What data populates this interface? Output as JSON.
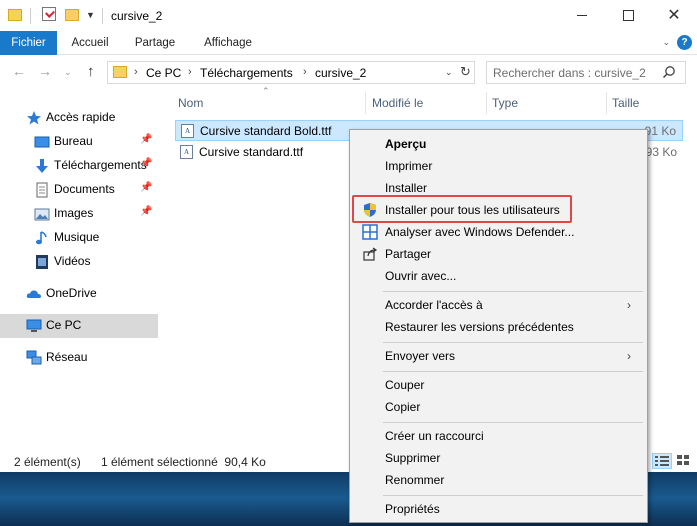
{
  "window": {
    "title": "cursive_2"
  },
  "ribbon": {
    "tabs": [
      {
        "label": "Fichier"
      },
      {
        "label": "Accueil"
      },
      {
        "label": "Partage"
      },
      {
        "label": "Affichage"
      }
    ]
  },
  "address": {
    "crumbs": [
      "Ce PC",
      "Téléchargements",
      "cursive_2"
    ]
  },
  "search": {
    "placeholder": "Rechercher dans : cursive_2"
  },
  "sidebar": {
    "quick_access": "Accès rapide",
    "items": [
      {
        "label": "Bureau",
        "icon": "desktop-icon"
      },
      {
        "label": "Téléchargements",
        "icon": "download-icon"
      },
      {
        "label": "Documents",
        "icon": "documents-icon"
      },
      {
        "label": "Images",
        "icon": "images-icon"
      },
      {
        "label": "Musique",
        "icon": "music-icon"
      },
      {
        "label": "Vidéos",
        "icon": "videos-icon"
      }
    ],
    "onedrive": "OneDrive",
    "this_pc": "Ce PC",
    "network": "Réseau"
  },
  "columns": {
    "name": "Nom",
    "modified": "Modifié le",
    "type": "Type",
    "size": "Taille"
  },
  "files": [
    {
      "name": "Cursive standard Bold.ttf",
      "size": "91 Ko",
      "selected": true
    },
    {
      "name": "Cursive standard.ttf",
      "size": "93 Ko",
      "selected": false
    }
  ],
  "status": {
    "count": "2 élément(s)",
    "selection": "1 élément sélectionné  90,4 Ko"
  },
  "context_menu": {
    "items": [
      {
        "label": "Aperçu"
      },
      {
        "label": "Imprimer"
      },
      {
        "label": "Installer"
      },
      {
        "label": "Installer pour tous les utilisateurs"
      },
      {
        "label": "Analyser avec Windows Defender..."
      },
      {
        "label": "Partager"
      },
      {
        "label": "Ouvrir avec..."
      },
      {
        "label": "Accorder l'accès à"
      },
      {
        "label": "Restaurer les versions précédentes"
      },
      {
        "label": "Envoyer vers"
      },
      {
        "label": "Couper"
      },
      {
        "label": "Copier"
      },
      {
        "label": "Créer un raccourci"
      },
      {
        "label": "Supprimer"
      },
      {
        "label": "Renommer"
      },
      {
        "label": "Propriétés"
      }
    ]
  },
  "colors": {
    "file_tab": "#1979ca",
    "selection": "#cce8ff",
    "highlight_border": "#e04848"
  }
}
